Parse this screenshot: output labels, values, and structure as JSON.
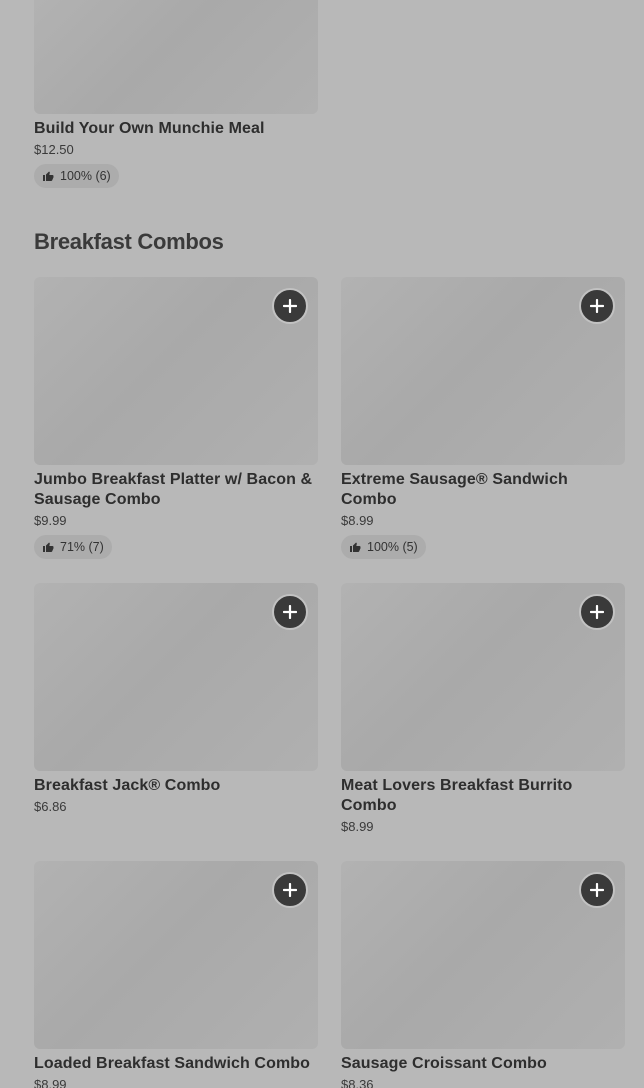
{
  "top_item": {
    "name": "Build Your Own Munchie Meal",
    "price": "$12.50",
    "rating": "100% (6)"
  },
  "section": {
    "title": "Breakfast Combos"
  },
  "items": [
    {
      "name": "Jumbo Breakfast Platter w/ Bacon & Sausage Combo",
      "price": "$9.99",
      "rating": "71% (7)"
    },
    {
      "name": "Extreme Sausage® Sandwich Combo",
      "price": "$8.99",
      "rating": "100% (5)"
    },
    {
      "name": "Breakfast Jack® Combo",
      "price": "$6.86"
    },
    {
      "name": "Meat Lovers Breakfast Burrito Combo",
      "price": "$8.99"
    },
    {
      "name": "Loaded Breakfast Sandwich Combo",
      "price": "$8.99"
    },
    {
      "name": "Sausage Croissant Combo",
      "price": "$8.36"
    }
  ],
  "icons": {
    "add": "plus-icon",
    "rating": "thumbs-up-icon"
  },
  "colors": {
    "background": "#b8b8b8",
    "button": "#3a3a3a"
  }
}
